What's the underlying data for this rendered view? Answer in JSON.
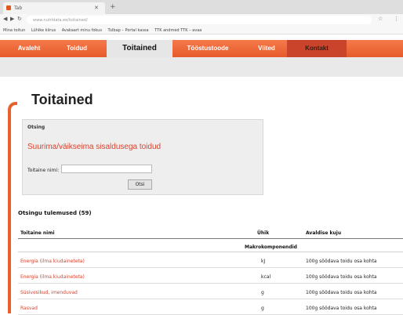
{
  "browser": {
    "tab_title": "Tab",
    "url": "www.nutridata.ee/toitained/",
    "bookmarks": [
      "Mina toitun",
      "Lühike kiirus",
      "Avakaart minu fokus",
      "Tulbap – Portal kassa",
      "TTK andmed TTK – avaa"
    ]
  },
  "nav": {
    "items": [
      {
        "label": "Avaleht",
        "state": "normal"
      },
      {
        "label": "Toidud",
        "state": "normal"
      },
      {
        "label": "Toitained",
        "state": "active"
      },
      {
        "label": "Tööstustoode",
        "state": "normal"
      },
      {
        "label": "Viited",
        "state": "normal"
      },
      {
        "label": "Kontakt",
        "state": "highlight"
      }
    ]
  },
  "page": {
    "title": "Toitained"
  },
  "search": {
    "legend": "Otsing",
    "link_text": "Suurima/väikseima sisaldusega toidud",
    "field_label": "Toitaine nimi:",
    "field_value": "",
    "button_label": "Otsi"
  },
  "results": {
    "heading": "Otsingu tulemused (59)",
    "columns": [
      "Toitaine nimi",
      "Ühik",
      "Avaldise kuju"
    ],
    "group": "Makrokomponendid",
    "rows": [
      {
        "name": "Energia (ilma kiudaineteta)",
        "unit": "kJ",
        "form": "100g söödava toidu osa kohta"
      },
      {
        "name": "Energia (ilma kiudaineteta)",
        "unit": "kcal",
        "form": "100g söödava toidu osa kohta"
      },
      {
        "name": "Süsivesikud, imenduvad",
        "unit": "g",
        "form": "100g söödava toidu osa kohta"
      },
      {
        "name": "Rasvad",
        "unit": "g",
        "form": "100g söödava toidu osa kohta"
      }
    ]
  },
  "colors": {
    "brand_orange": "#e85a2a",
    "link_red": "#d8432f"
  }
}
